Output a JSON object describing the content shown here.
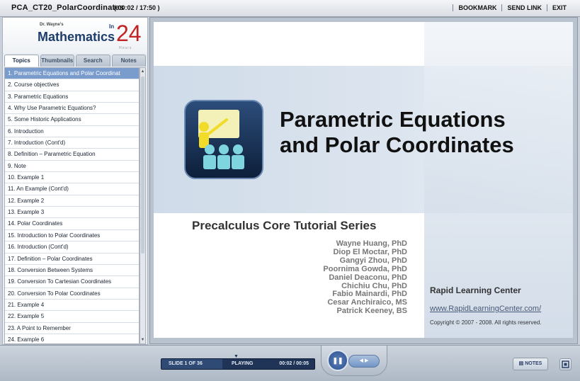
{
  "titlebar": {
    "title": "PCA_CT20_PolarCoordinates",
    "time": "( 00:02 / 17:50 )",
    "links": [
      "BOOKMARK",
      "SEND LINK",
      "EXIT"
    ]
  },
  "logo": {
    "small": "Dr. Wayne's",
    "big": "Mathematics",
    "in": "In",
    "num": "24",
    "hours": "Hours"
  },
  "tabs": [
    "Topics",
    "Thumbnails",
    "Search",
    "Notes"
  ],
  "topics": [
    "1. Parametric Equations and Polar Coordinat",
    "2. Course objectives",
    "3. Parametric Equations",
    "4. Why Use Parametric Equations?",
    "5. Some Historic Applications",
    "6. Introduction",
    "7. Introduction (Cont'd)",
    "8. Definition – Parametric Equation",
    "9. Note",
    "10. Example 1",
    "11. An Example (Cont'd)",
    "12. Example 2",
    "13. Example 3",
    "14. Polar Coordinates",
    "15. Introduction to Polar Coordinates",
    "16. Introduction (Cont'd)",
    "17. Definition – Polar Coordinates",
    "18. Conversion Between Systems",
    "19. Conversion To Cartesian Coordinates",
    "20. Conversion To Polar Coordinates",
    "21. Example 4",
    "22. Example 5",
    "23. A Point to Remember",
    "24. Example 6"
  ],
  "slide": {
    "title_line1": "Parametric Equations",
    "title_line2": "and Polar Coordinates",
    "series": "Precalculus Core Tutorial Series",
    "authors": [
      "Wayne Huang, PhD",
      "Diop El Moctar, PhD",
      "Gangyi Zhou, PhD",
      "Poornima Gowda, PhD",
      "Daniel Deaconu, PhD",
      "Chichiu Chu, PhD",
      "Fabio Mainardi, PhD",
      "Cesar Anchiraico,  MS",
      "Patrick Keeney,  BS"
    ],
    "org": "Rapid Learning Center",
    "url": "www.RapidLearningCenter.com/",
    "copyright": "Copyright © 2007 - 2008. All rights reserved."
  },
  "controls": {
    "slide_label": "SLIDE 1 OF 36",
    "status": "PLAYING",
    "time": "00:02 / 00:05",
    "progress": 0.4,
    "notes_label": "NOTES"
  }
}
